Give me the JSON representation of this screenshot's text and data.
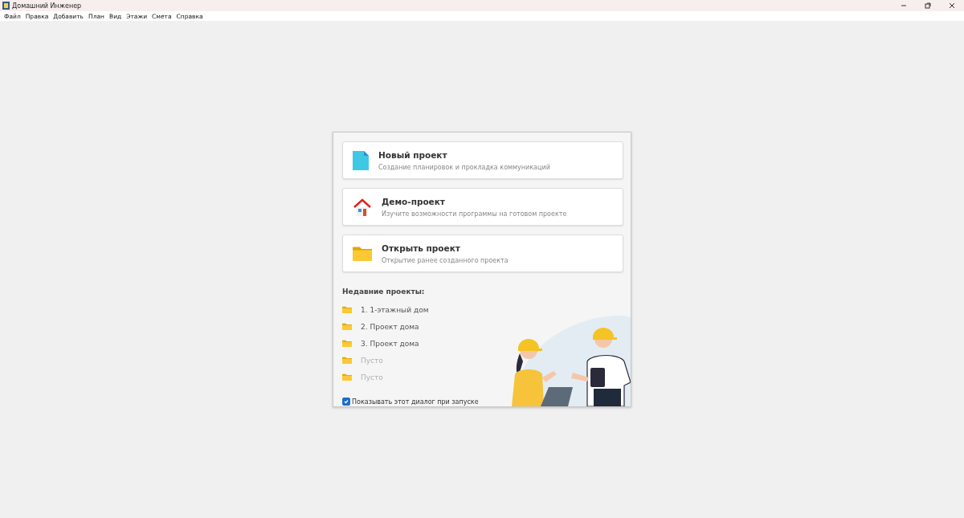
{
  "window": {
    "title": "Домашний Инженер"
  },
  "menu": [
    "Файл",
    "Правка",
    "Добавить",
    "План",
    "Вид",
    "Этажи",
    "Смета",
    "Справка"
  ],
  "actions": [
    {
      "kind": "new",
      "title": "Новый проект",
      "subtitle": "Создание планировок и прокладка коммуникаций"
    },
    {
      "kind": "demo",
      "title": "Демо-проект",
      "subtitle": "Изучите возможности программы на готовом проекте"
    },
    {
      "kind": "open",
      "title": "Открыть проект",
      "subtitle": "Открытие ранее созданного проекта"
    }
  ],
  "recent": {
    "heading": "Недавние проекты:",
    "items": [
      {
        "label": "1. 1-этажный дом",
        "disabled": false
      },
      {
        "label": "2. Проект дома",
        "disabled": false
      },
      {
        "label": "3. Проект дома",
        "disabled": false
      },
      {
        "label": "Пусто",
        "disabled": true
      },
      {
        "label": "Пусто",
        "disabled": true
      }
    ]
  },
  "show_on_startup": {
    "label": "Показывать этот диалог при запуске",
    "checked": true
  }
}
